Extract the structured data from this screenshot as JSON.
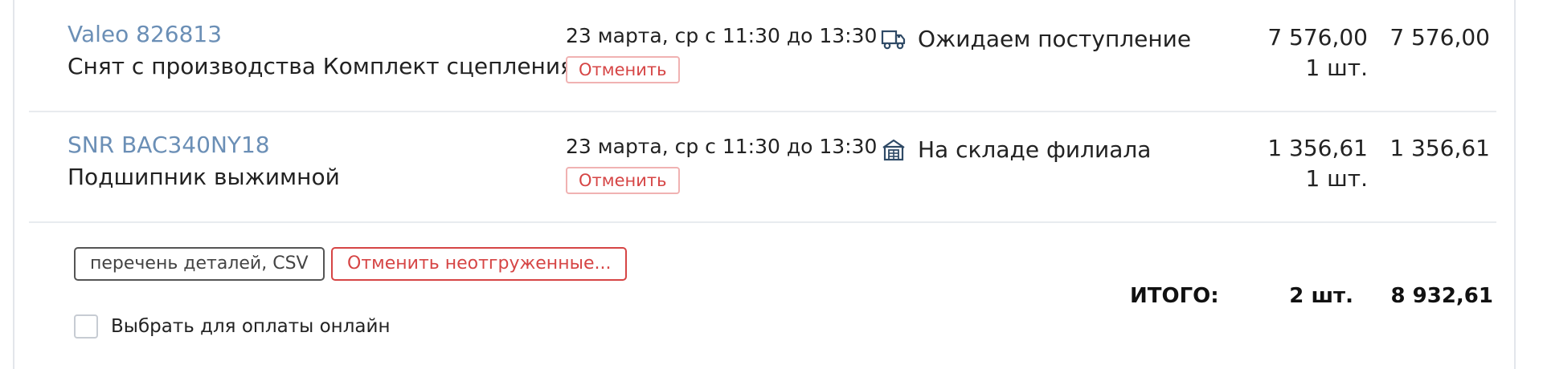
{
  "items": [
    {
      "part_link": "Valeo 826813",
      "description": "Снят с производства Комплект сцепления",
      "delivery": "23 марта, ср с 11:30 до 13:30",
      "cancel_label": "Отменить",
      "status_icon": "truck-icon",
      "status_text": "Ожидаем поступление",
      "price": "7 576,00",
      "quantity": "1 шт.",
      "sum": "7 576,00"
    },
    {
      "part_link": "SNR BAC340NY18",
      "description": "Подшипник выжимной",
      "delivery": "23 марта, ср с 11:30 до 13:30",
      "cancel_label": "Отменить",
      "status_icon": "warehouse-icon",
      "status_text": "На складе филиала",
      "price": "1 356,61",
      "quantity": "1 шт.",
      "sum": "1 356,61"
    }
  ],
  "footer": {
    "csv_button": "перечень деталей, CSV",
    "cancel_unshipped_button": "Отменить неотгруженные...",
    "pay_online_label": "Выбрать для оплаты онлайн",
    "pay_online_checked": false,
    "total_label": "ИТОГО:",
    "total_quantity": "2 шт.",
    "total_sum": "8 932,61"
  },
  "colors": {
    "link": "#6b8fb6",
    "danger": "#d64545",
    "divider": "#e8ebef",
    "icon": "#2f4a66"
  }
}
